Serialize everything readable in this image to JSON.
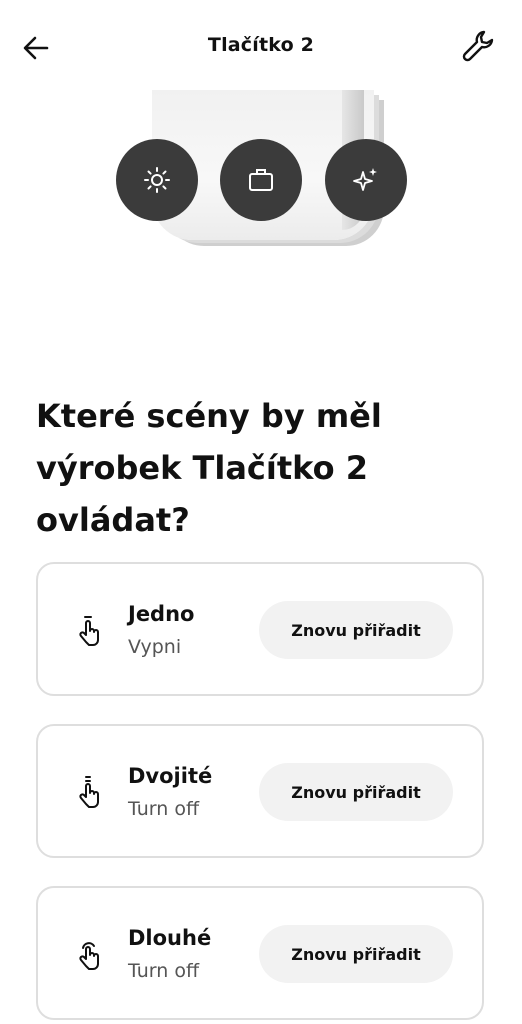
{
  "header": {
    "title": "Tlačítko 2",
    "back_icon": "arrow-left-icon",
    "settings_icon": "wrench-icon"
  },
  "device": {
    "mode_buttons": [
      {
        "icon": "brightness-icon"
      },
      {
        "icon": "briefcase-icon"
      },
      {
        "icon": "sparkle-icon"
      }
    ]
  },
  "main": {
    "heading": "Které scény by měl výrobek Tlačítko 2 ovládat?",
    "actions": [
      {
        "title": "Jedno",
        "scene": "Vypni",
        "button_label": "Znovu přiřadit",
        "icon": "single-press-icon"
      },
      {
        "title": "Dvojité",
        "scene": "Turn off",
        "button_label": "Znovu přiřadit",
        "icon": "double-press-icon"
      },
      {
        "title": "Dlouhé",
        "scene": "Turn off",
        "button_label": "Znovu přiřadit",
        "icon": "long-press-icon"
      }
    ]
  },
  "colors": {
    "mode_button_bg": "#3b3b3b",
    "card_border": "#dedede",
    "button_bg": "#f2f2f2",
    "text_primary": "#111111",
    "text_secondary": "#555555"
  }
}
